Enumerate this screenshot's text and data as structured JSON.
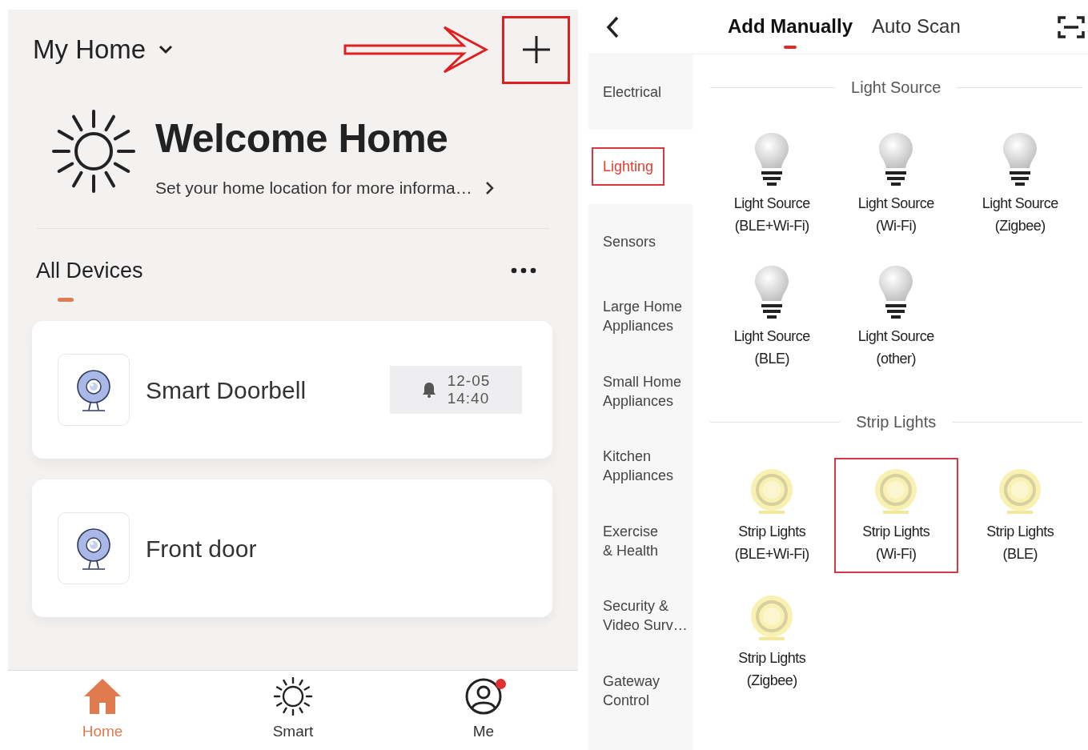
{
  "home_screen": {
    "home_name": "My Home",
    "add_button_highlighted": true,
    "welcome_title": "Welcome Home",
    "location_prompt": "Set your home location for more informa…",
    "section_tabs": [
      {
        "label": "All Devices",
        "selected": true
      }
    ],
    "devices": [
      {
        "name": "Smart Doorbell",
        "alert": {
          "date": "12-05",
          "time": "14:40"
        }
      },
      {
        "name": "Front door"
      }
    ],
    "nav": [
      {
        "kind": "home",
        "label": "Home",
        "selected": true
      },
      {
        "kind": "smart",
        "label": "Smart",
        "selected": false
      },
      {
        "kind": "me",
        "label": "Me",
        "selected": false,
        "notification": true
      }
    ]
  },
  "add_device_screen": {
    "tabs": [
      {
        "label": "Add Manually",
        "selected": true
      },
      {
        "label": "Auto Scan",
        "selected": false
      }
    ],
    "categories": [
      {
        "label": "Electrical",
        "selected": false,
        "highlighted": false
      },
      {
        "label": "Lighting",
        "selected": true,
        "highlighted": true
      },
      {
        "label": "Sensors",
        "selected": false,
        "highlighted": false
      },
      {
        "label": "Large Home\nAppliances",
        "selected": false,
        "highlighted": false
      },
      {
        "label": "Small Home\nAppliances",
        "selected": false,
        "highlighted": false
      },
      {
        "label": "Kitchen\nAppliances",
        "selected": false,
        "highlighted": false
      },
      {
        "label": "Exercise\n& Health",
        "selected": false,
        "highlighted": false
      },
      {
        "label": "Security &\nVideo Surv…",
        "selected": false,
        "highlighted": false
      },
      {
        "label": "Gateway\nControl",
        "selected": false,
        "highlighted": false
      }
    ],
    "sections": [
      {
        "title": "Light Source",
        "kind": "bulb",
        "items": [
          {
            "name": "Light Source",
            "variant": "(BLE+Wi-Fi)",
            "highlighted": false
          },
          {
            "name": "Light Source",
            "variant": "(Wi-Fi)",
            "highlighted": false
          },
          {
            "name": "Light Source",
            "variant": "(Zigbee)",
            "highlighted": false
          },
          {
            "name": "Light Source",
            "variant": "(BLE)",
            "highlighted": false
          },
          {
            "name": "Light Source",
            "variant": "(other)",
            "highlighted": false
          }
        ]
      },
      {
        "title": "Strip Lights",
        "kind": "strip",
        "items": [
          {
            "name": "Strip Lights",
            "variant": "(BLE+Wi-Fi)",
            "highlighted": false
          },
          {
            "name": "Strip Lights",
            "variant": "(Wi-Fi)",
            "highlighted": true
          },
          {
            "name": "Strip Lights",
            "variant": "(BLE)",
            "highlighted": false
          },
          {
            "name": "Strip Lights",
            "variant": "(Zigbee)",
            "highlighted": false
          }
        ]
      }
    ]
  }
}
